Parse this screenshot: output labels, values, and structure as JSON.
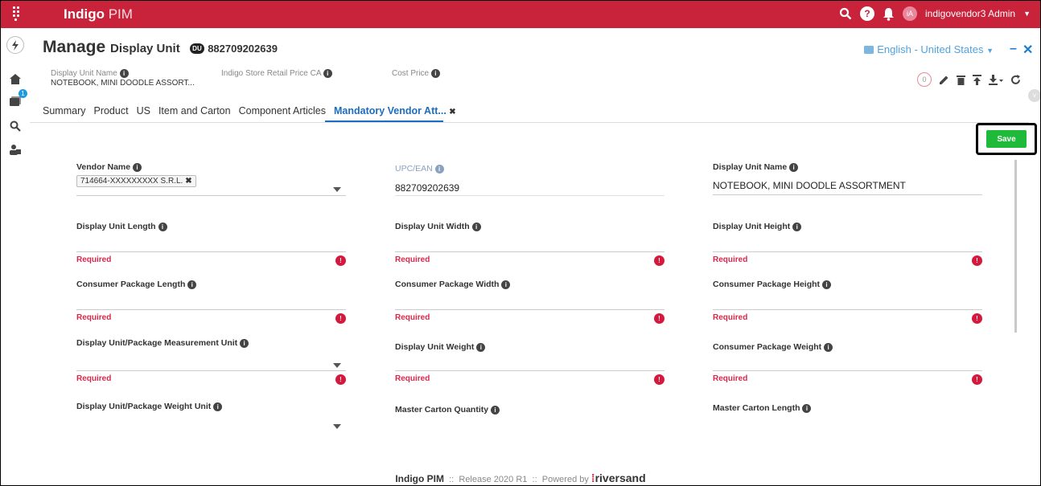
{
  "app": {
    "brand_bold": "Indigo",
    "brand_rest": "PIM",
    "user": "indigovendor3 Admin",
    "avatar_initials": "iA",
    "accent": "#c8233b"
  },
  "nav": {
    "notif_count": "1"
  },
  "header": {
    "title_main": "Manage",
    "title_sub": "Display Unit",
    "badge": "DU",
    "item_id": "882709202639",
    "locale": "English - United States"
  },
  "meta": {
    "display_unit_name_label": "Display Unit Name",
    "display_unit_name_value": "NOTEBOOK, MINI DOODLE ASSORT...",
    "retail_price_label": "Indigo Store Retail Price CA",
    "cost_price_label": "Cost Price"
  },
  "toolbar": {
    "count": "0"
  },
  "tabs": [
    {
      "label": "Summary"
    },
    {
      "label": "Product"
    },
    {
      "label": "US"
    },
    {
      "label": "Item and Carton"
    },
    {
      "label": "Component Articles"
    },
    {
      "label": "Mandatory Vendor Att..."
    }
  ],
  "save_label": "Save",
  "required_text": "Required",
  "err_mark": "!",
  "fields": {
    "vendor_name": {
      "label": "Vendor Name",
      "chip": "714664-XXXXXXXXX S.R.L."
    },
    "upc": {
      "label": "UPC/EAN",
      "value": "882709202639"
    },
    "du_name": {
      "label": "Display Unit Name",
      "value": "NOTEBOOK, MINI DOODLE ASSORTMENT"
    },
    "du_length": {
      "label": "Display Unit Length"
    },
    "du_width": {
      "label": "Display Unit Width"
    },
    "du_height": {
      "label": "Display Unit Height"
    },
    "cp_length": {
      "label": "Consumer Package Length"
    },
    "cp_width": {
      "label": "Consumer Package Width"
    },
    "cp_height": {
      "label": "Consumer Package Height"
    },
    "meas_unit": {
      "label": "Display Unit/Package Measurement Unit"
    },
    "du_weight": {
      "label": "Display Unit Weight"
    },
    "cp_weight": {
      "label": "Consumer Package Weight"
    },
    "weight_unit": {
      "label": "Display Unit/Package Weight Unit"
    },
    "mc_qty": {
      "label": "Master Carton Quantity"
    },
    "mc_length": {
      "label": "Master Carton Length"
    }
  },
  "footer": {
    "product": "Indigo PIM",
    "release": "Release 2020 R1",
    "powered": "Powered by",
    "vendor": "riversand",
    "sep": "::"
  }
}
